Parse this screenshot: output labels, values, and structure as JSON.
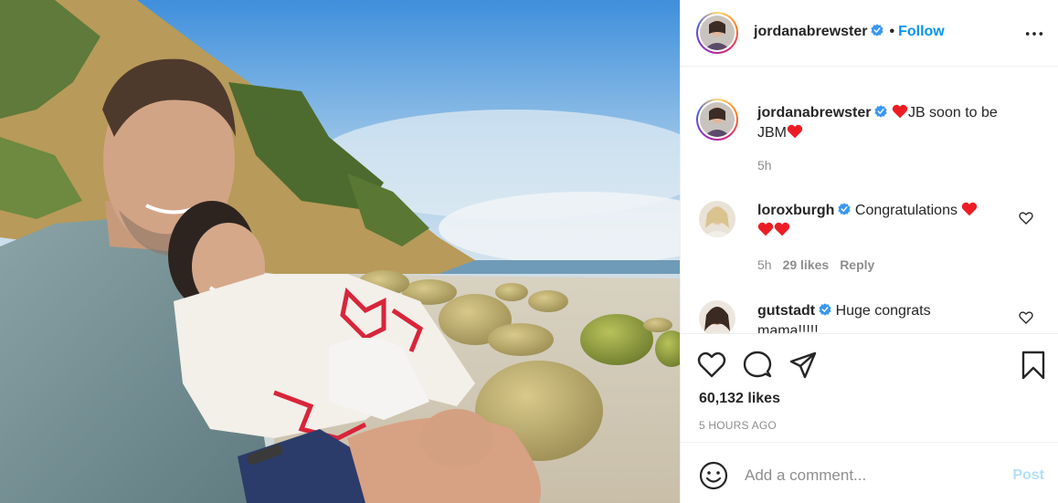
{
  "post": {
    "author": "jordanabrewster",
    "follow_label": "Follow",
    "separator": "•",
    "caption": {
      "username": "jordanabrewster",
      "text_before": "JB soon to be",
      "text_after": "JBM",
      "time": "5h"
    },
    "comments": [
      {
        "username": "loroxburgh",
        "text": "Congratulations",
        "time": "5h",
        "likes": "29 likes",
        "reply": "Reply"
      },
      {
        "username": "gutstadt",
        "text": "Huge congrats",
        "text_line2": "mama!!!!!"
      }
    ],
    "likes_count": "60,132 likes",
    "posted_ago": "5 HOURS AGO"
  },
  "composer": {
    "placeholder": "Add a comment...",
    "post_label": "Post"
  },
  "icons": [
    "verified-badge-icon",
    "more-options-icon",
    "heart-icon",
    "comment-icon",
    "share-icon",
    "bookmark-icon",
    "emoji-icon",
    "red-heart-emoji"
  ],
  "colors": {
    "accent": "#0095f6",
    "text": "#262626",
    "muted": "#8e8e8e",
    "post_disabled": "#b2dffc",
    "heart": "#ed1c24"
  }
}
